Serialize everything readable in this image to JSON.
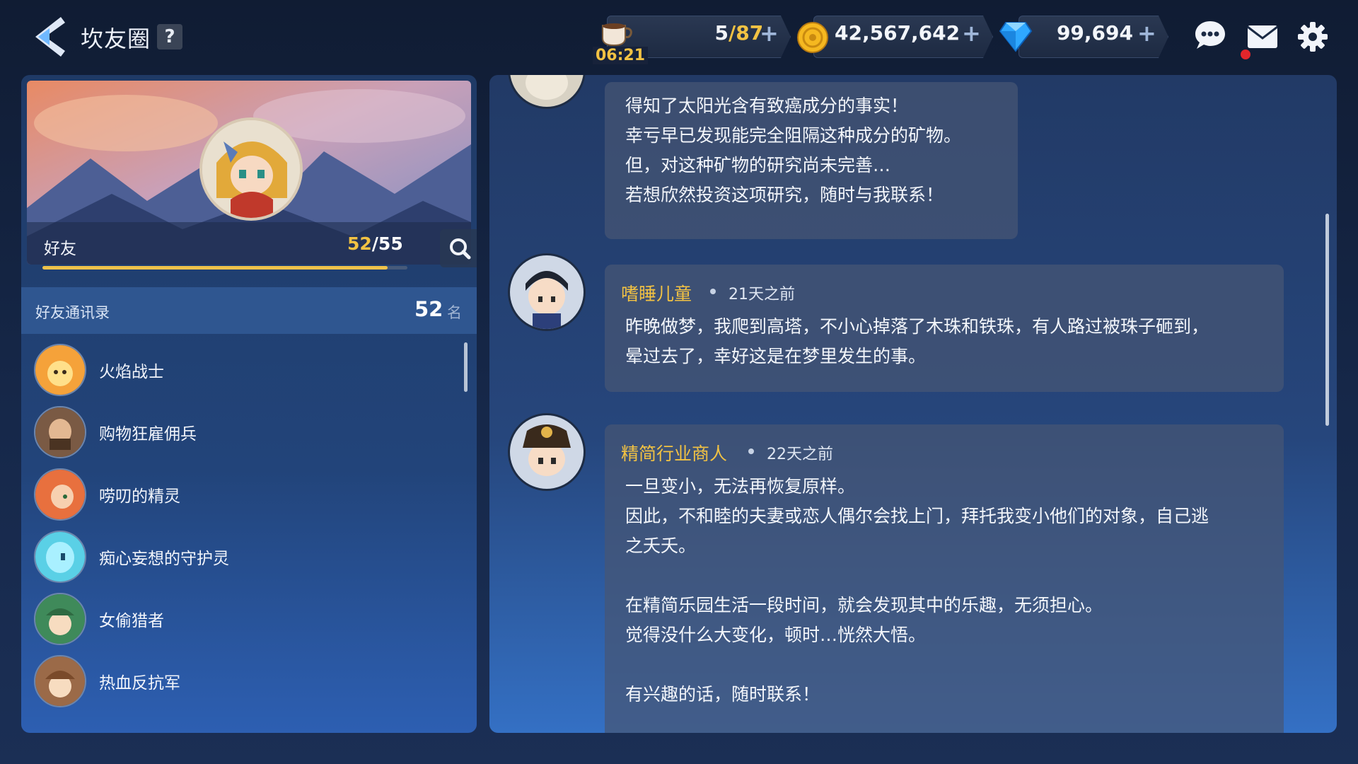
{
  "header": {
    "title": "坎友圈",
    "help_label": "?",
    "stamina": {
      "current": "5",
      "max": "/87",
      "plus": "+",
      "timer": "06:21",
      "icon": "coffee-cup-icon"
    },
    "gold": {
      "value": "42,567,642",
      "plus": "+",
      "icon": "gold-coin-icon"
    },
    "gems": {
      "value": "99,694",
      "plus": "+",
      "icon": "blue-diamond-icon"
    },
    "icons": [
      "chat-bubble-icon",
      "mail-icon",
      "gear-icon"
    ],
    "mail_notification": true
  },
  "profile": {
    "label": "好友",
    "friends_current": "52",
    "friends_max": "/55",
    "friends_progress": 0.945
  },
  "friend_list": {
    "title": "好友通讯录",
    "count": "52",
    "unit": "名",
    "items": [
      {
        "name": "火焰战士",
        "color": "#f5a23a"
      },
      {
        "name": "购物狂雇佣兵",
        "color": "#7a5a44"
      },
      {
        "name": "唠叨的精灵",
        "color": "#e8703e"
      },
      {
        "name": "痴心妄想的守护灵",
        "color": "#5ad0e6"
      },
      {
        "name": "女偷猎者",
        "color": "#3f8a5a"
      },
      {
        "name": "热血反抗军",
        "color": "#9b6a48"
      }
    ]
  },
  "posts": [
    {
      "author": "",
      "time": "",
      "lines": [
        "得知了太阳光含有致癌成分的事实！",
        "幸亏早已发现能完全阻隔这种成分的矿物。",
        "但，对这种矿物的研究尚未完善…",
        "若想欣然投资这项研究，随时与我联系！"
      ]
    },
    {
      "author": "嗜睡儿童",
      "time": "21天之前",
      "lines": [
        "昨晚做梦，我爬到高塔，不小心掉落了木珠和铁珠，有人路过被珠子砸到，",
        "晕过去了，幸好这是在梦里发生的事。"
      ]
    },
    {
      "author": "精简行业商人",
      "time": "22天之前",
      "lines": [
        "一旦变小，无法再恢复原样。",
        "因此，不和睦的夫妻或恋人偶尔会找上门，拜托我变小他们的对象，自己逃",
        "之夭夭。",
        "",
        "在精简乐园生活一段时间，就会发现其中的乐趣，无须担心。",
        "觉得没什么大变化，顿时…恍然大悟。",
        "",
        "有兴趣的话，随时联系！"
      ]
    }
  ]
}
